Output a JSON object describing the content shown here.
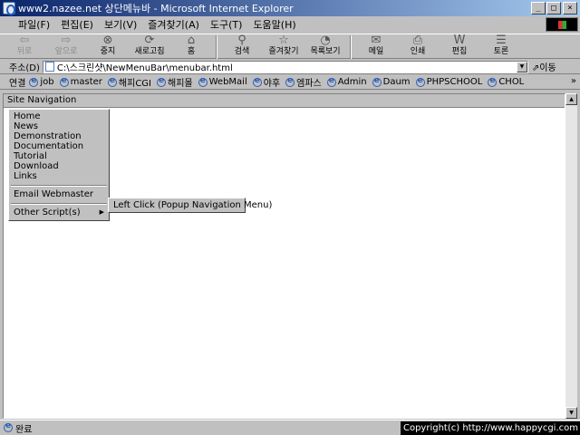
{
  "window": {
    "title": "www2.nazee.net 상단메뉴바 - Microsoft Internet Explorer",
    "buttons": {
      "minimize": "_",
      "maximize": "□",
      "close": "×"
    }
  },
  "menubar": [
    "파일(F)",
    "편집(E)",
    "보기(V)",
    "즐겨찾기(A)",
    "도구(T)",
    "도움말(H)"
  ],
  "toolbar": [
    {
      "label": "뒤로",
      "icon": "back-arrow-icon",
      "glyph": "⇦",
      "disabled": true,
      "drop": true
    },
    {
      "label": "앞으로",
      "icon": "forward-arrow-icon",
      "glyph": "⇨",
      "disabled": true,
      "drop": true
    },
    {
      "label": "중지",
      "icon": "stop-icon",
      "glyph": "⊗",
      "disabled": false,
      "drop": false
    },
    {
      "label": "새로고침",
      "icon": "refresh-icon",
      "glyph": "⟳",
      "disabled": false,
      "drop": false
    },
    {
      "label": "홈",
      "icon": "home-icon",
      "glyph": "⌂",
      "disabled": false,
      "drop": false
    },
    {
      "label": "검색",
      "icon": "search-icon",
      "glyph": "⚲",
      "disabled": false,
      "drop": false
    },
    {
      "label": "즐겨찾기",
      "icon": "favorites-icon",
      "glyph": "☆",
      "disabled": false,
      "drop": false
    },
    {
      "label": "목록보기",
      "icon": "history-icon",
      "glyph": "◔",
      "disabled": false,
      "drop": false
    },
    {
      "label": "메일",
      "icon": "mail-icon",
      "glyph": "✉",
      "disabled": false,
      "drop": true
    },
    {
      "label": "인쇄",
      "icon": "print-icon",
      "glyph": "⎙",
      "disabled": false,
      "drop": false
    },
    {
      "label": "편집",
      "icon": "edit-icon",
      "glyph": "W",
      "disabled": false,
      "drop": true
    },
    {
      "label": "토론",
      "icon": "discuss-icon",
      "glyph": "☰",
      "disabled": false,
      "drop": false
    }
  ],
  "address": {
    "label": "주소(D)",
    "value": "C:\\스크린샷\\NewMenuBar\\menubar.html",
    "go_label": "⇗이동"
  },
  "links": {
    "label": "연결",
    "items": [
      "job",
      "master",
      "해피CGI",
      "해피몰",
      "WebMail",
      "야후",
      "엠파스",
      "Admin",
      "Daum",
      "PHPSCHOOL",
      "CHOL"
    ],
    "more": "»"
  },
  "site_nav": {
    "title": "Site Navigation",
    "items": [
      "Home",
      "News",
      "Demonstration",
      "Documentation",
      "Tutorial",
      "Download",
      "Links"
    ],
    "email": "Email Webmaster",
    "other": "Other Script(s)",
    "submenu": [
      "Left Click (Popup Navigation Menu)"
    ]
  },
  "status": {
    "text": "완료",
    "copyright": "Copyright(c) http://www.happycgi.com"
  }
}
